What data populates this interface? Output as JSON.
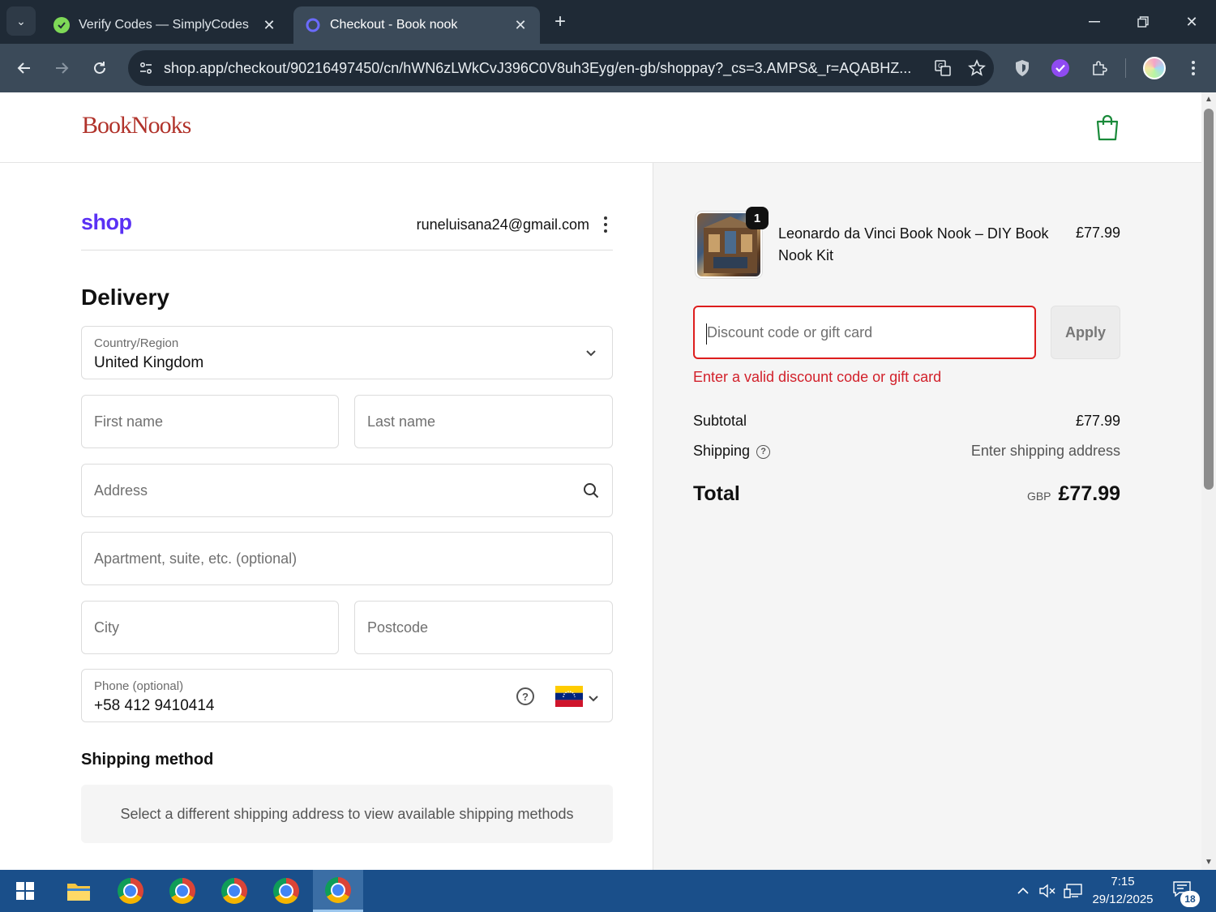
{
  "browser": {
    "tabs": [
      {
        "title": "Verify Codes — SimplyCodes",
        "active": false
      },
      {
        "title": "Checkout - Book nook",
        "active": true
      }
    ],
    "url": "shop.app/checkout/90216497450/cn/hWN6zLWkCvJ396C0V8uh3Eyg/en-gb/shoppay?_cs=3.AMPS&_r=AQABHZ..."
  },
  "header": {
    "brand": "BookNooks"
  },
  "account": {
    "shop_logo": "shop",
    "email": "runeluisana24@gmail.com"
  },
  "delivery": {
    "title": "Delivery",
    "country_label": "Country/Region",
    "country_value": "United Kingdom",
    "first_name_placeholder": "First name",
    "last_name_placeholder": "Last name",
    "address_placeholder": "Address",
    "apartment_placeholder": "Apartment, suite, etc. (optional)",
    "city_placeholder": "City",
    "postcode_placeholder": "Postcode",
    "phone_label": "Phone (optional)",
    "phone_value": "+58 412 9410414"
  },
  "shipping_method": {
    "title": "Shipping method",
    "message": "Select a different shipping address to view available shipping methods"
  },
  "summary": {
    "product_name": "Leonardo da Vinci Book Nook – DIY Book Nook Kit",
    "product_price": "£77.99",
    "quantity": "1",
    "discount_placeholder": "Discount code or gift card",
    "apply_label": "Apply",
    "error_message": "Enter a valid discount code or gift card",
    "subtotal_label": "Subtotal",
    "subtotal_value": "£77.99",
    "shipping_label": "Shipping",
    "shipping_value": "Enter shipping address",
    "total_label": "Total",
    "total_currency": "GBP",
    "total_value": "£77.99"
  },
  "taskbar": {
    "time": "7:15",
    "date": "29/12/2025",
    "notifications": "18"
  },
  "colors": {
    "shop_purple": "#5a31f4",
    "brand_red": "#b1332b",
    "error_red": "#d2212b",
    "cart_green": "#1a8a3a"
  }
}
